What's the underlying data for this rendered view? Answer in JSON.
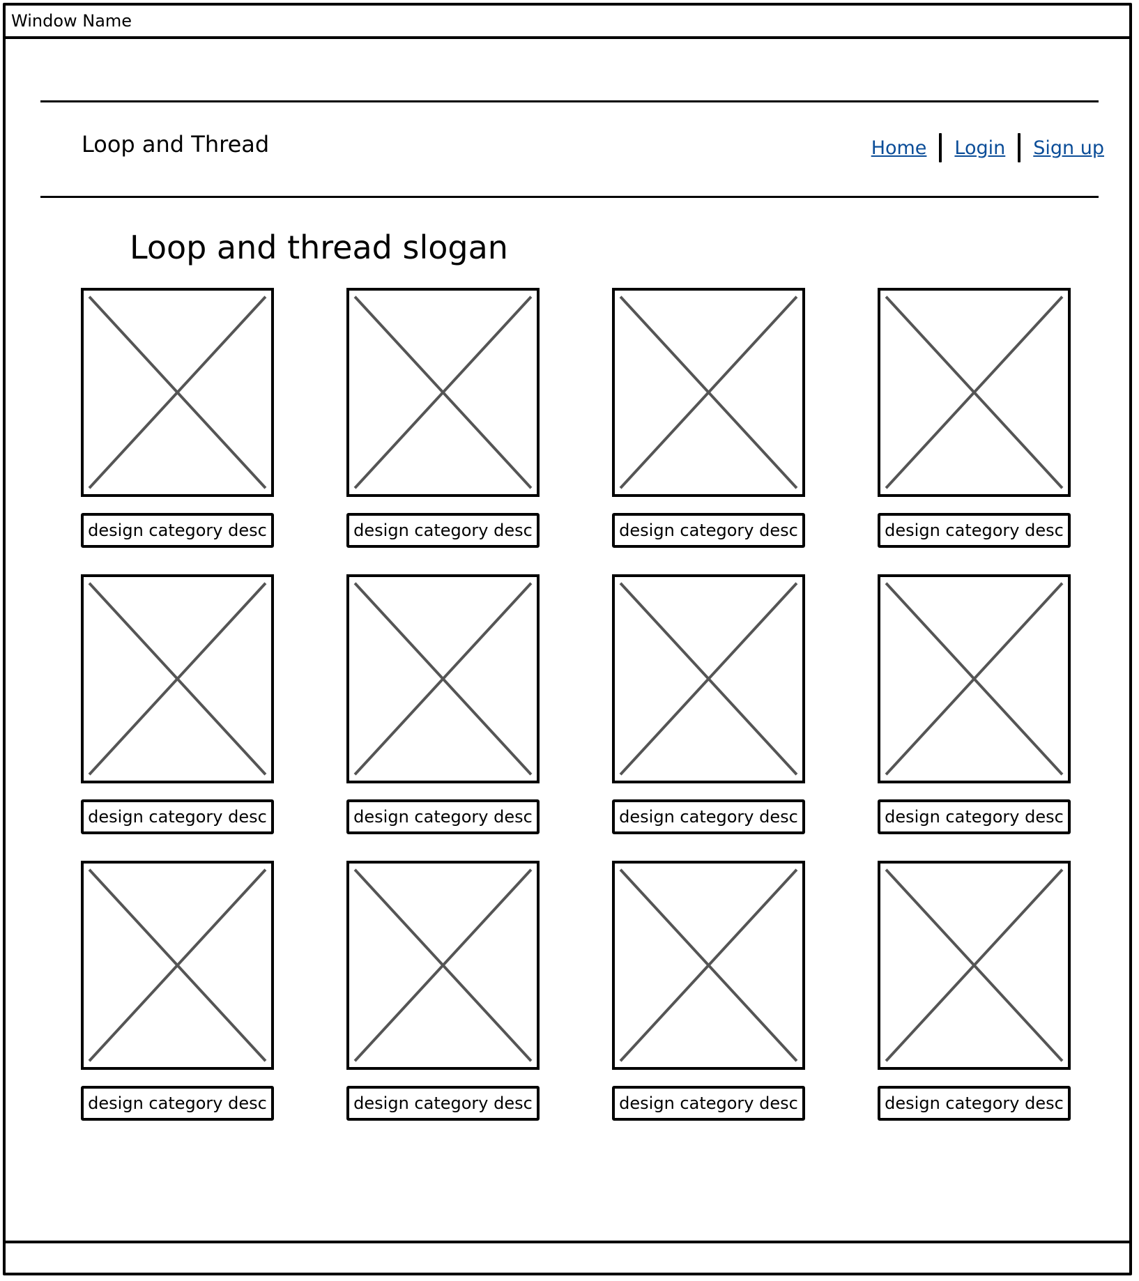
{
  "window": {
    "title": "Window Name"
  },
  "header": {
    "brand": "Loop and Thread",
    "nav": [
      {
        "label": "Home"
      },
      {
        "label": "Login"
      },
      {
        "label": "Sign up"
      }
    ],
    "link_color": "#0b4d98"
  },
  "main": {
    "slogan": "Loop and thread slogan",
    "categories": [
      {
        "image_icon": "image-placeholder-icon",
        "desc": "design category desc"
      },
      {
        "image_icon": "image-placeholder-icon",
        "desc": "design category desc"
      },
      {
        "image_icon": "image-placeholder-icon",
        "desc": "design category desc"
      },
      {
        "image_icon": "image-placeholder-icon",
        "desc": "design category desc"
      },
      {
        "image_icon": "image-placeholder-icon",
        "desc": "design category desc"
      },
      {
        "image_icon": "image-placeholder-icon",
        "desc": "design category desc"
      },
      {
        "image_icon": "image-placeholder-icon",
        "desc": "design category desc"
      },
      {
        "image_icon": "image-placeholder-icon",
        "desc": "design category desc"
      },
      {
        "image_icon": "image-placeholder-icon",
        "desc": "design category desc"
      },
      {
        "image_icon": "image-placeholder-icon",
        "desc": "design category desc"
      },
      {
        "image_icon": "image-placeholder-icon",
        "desc": "design category desc"
      },
      {
        "image_icon": "image-placeholder-icon",
        "desc": "design category desc"
      }
    ]
  }
}
